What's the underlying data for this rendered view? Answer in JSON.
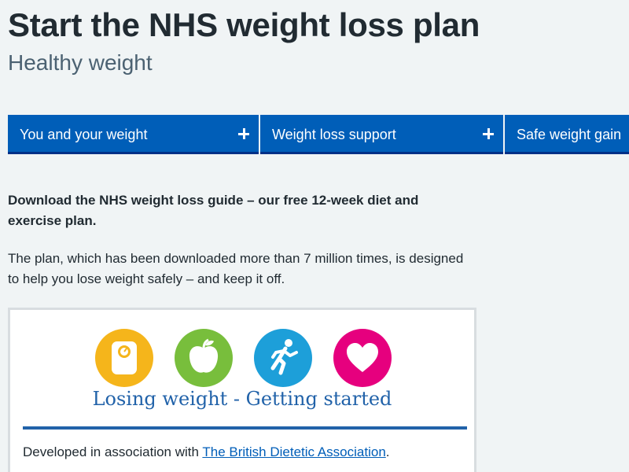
{
  "page": {
    "title": "Start the NHS weight loss plan",
    "subtitle": "Healthy weight"
  },
  "nav": {
    "items": [
      {
        "label": "You and your weight",
        "icon": "plus-icon"
      },
      {
        "label": "Weight loss support",
        "icon": "plus-icon"
      },
      {
        "label": "Safe weight gain",
        "icon": "plus-icon"
      }
    ]
  },
  "intro": {
    "lead": "Download the NHS weight loss guide – our free 12-week diet and exercise plan.",
    "body": "The plan, which has been downloaded more than 7 million times, is designed to help you lose weight safely – and keep it off."
  },
  "guide_card": {
    "icons": [
      {
        "name": "scales-icon",
        "color": "#f5b51b"
      },
      {
        "name": "apple-icon",
        "color": "#78be3c"
      },
      {
        "name": "runner-icon",
        "color": "#1d9fd9"
      },
      {
        "name": "heart-icon",
        "color": "#e6007e"
      }
    ],
    "heading": "Losing weight - Getting started",
    "credit_prefix": "Developed in association with ",
    "credit_link": "The British Dietetic Association",
    "credit_suffix": "."
  },
  "colors": {
    "nhs_blue": "#005eb8",
    "nav_border": "#003087",
    "background": "#f0f4f5",
    "text": "#212b32",
    "secondary_text": "#4c6272",
    "card_accent": "#2162a9"
  }
}
